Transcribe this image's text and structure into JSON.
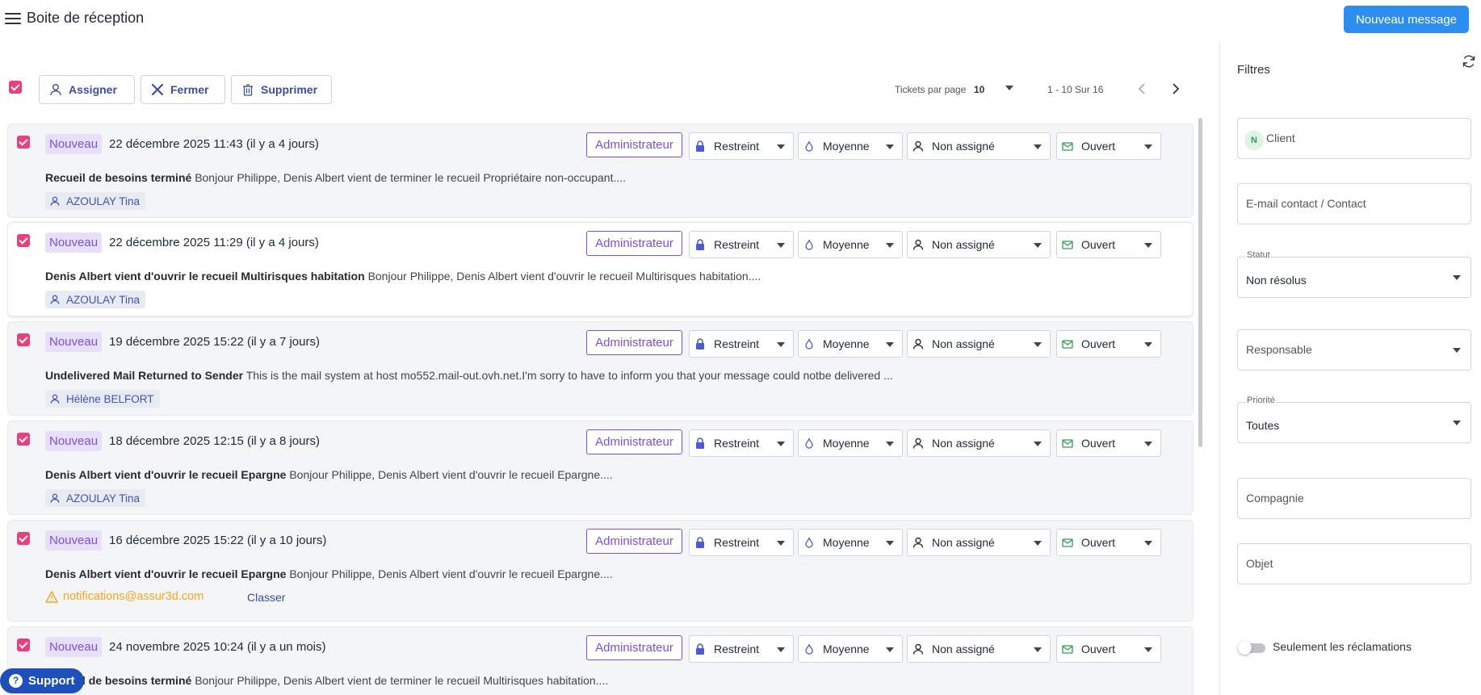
{
  "header": {
    "title": "Boite de réception",
    "new_message_label": "Nouveau message"
  },
  "toolbar": {
    "assign_label": "Assigner",
    "close_label": "Fermer",
    "delete_label": "Supprimer",
    "per_page_label": "Tickets par page",
    "per_page_value": "10",
    "range_text": "1 - 10 Sur 16"
  },
  "tickets": [
    {
      "status": "Nouveau",
      "date": "22 décembre 2025 11:43 (il y a 4 jours)",
      "role": "Administrateur",
      "visibility": "Restreint",
      "priority": "Moyenne",
      "assignee": "Non assigné",
      "state": "Ouvert",
      "subject": "Recueil de besoins terminé",
      "preview": "Bonjour Philippe, Denis Albert vient de terminer le recueil Propriétaire non-occupant....",
      "contact": "AZOULAY Tina"
    },
    {
      "status": "Nouveau",
      "date": "22 décembre 2025 11:29 (il y a 4 jours)",
      "role": "Administrateur",
      "visibility": "Restreint",
      "priority": "Moyenne",
      "assignee": "Non assigné",
      "state": "Ouvert",
      "subject": "Denis Albert vient d'ouvrir le recueil Multirisques habitation",
      "preview": "Bonjour Philippe, Denis Albert vient d'ouvrir le recueil Multirisques habitation....",
      "contact": "AZOULAY Tina"
    },
    {
      "status": "Nouveau",
      "date": "19 décembre 2025 15:22 (il y a 7 jours)",
      "role": "Administrateur",
      "visibility": "Restreint",
      "priority": "Moyenne",
      "assignee": "Non assigné",
      "state": "Ouvert",
      "subject": "Undelivered Mail Returned to Sender",
      "preview": "This is the mail system at host mo552.mail-out.ovh.net.I'm sorry to have to inform you that your message could notbe delivered ...",
      "contact": "Hélène BELFORT"
    },
    {
      "status": "Nouveau",
      "date": "18 décembre 2025 12:15 (il y a 8 jours)",
      "role": "Administrateur",
      "visibility": "Restreint",
      "priority": "Moyenne",
      "assignee": "Non assigné",
      "state": "Ouvert",
      "subject": "Denis Albert vient d'ouvrir le recueil Epargne",
      "preview": "Bonjour Philippe, Denis Albert vient d'ouvrir le recueil Epargne....",
      "contact": "AZOULAY Tina"
    },
    {
      "status": "Nouveau",
      "date": "16 décembre 2025 15:22 (il y a 10 jours)",
      "role": "Administrateur",
      "visibility": "Restreint",
      "priority": "Moyenne",
      "assignee": "Non assigné",
      "state": "Ouvert",
      "subject": "Denis Albert vient d'ouvrir le recueil Epargne",
      "preview": "Bonjour Philippe, Denis Albert vient d'ouvrir le recueil Epargne....",
      "warning_email": "notifications@assur3d.com",
      "classify_label": "Classer"
    },
    {
      "status": "Nouveau",
      "date": "24 novembre 2025 10:24 (il y a un mois)",
      "role": "Administrateur",
      "visibility": "Restreint",
      "priority": "Moyenne",
      "assignee": "Non assigné",
      "state": "Ouvert",
      "subject": "Recueil de besoins terminé",
      "preview": "Bonjour Philippe, Denis Albert vient de terminer le recueil Multirisques habitation...."
    }
  ],
  "filters": {
    "title": "Filtres",
    "client_initial": "N",
    "client_placeholder": "Client",
    "contact_placeholder": "E-mail contact / Contact",
    "status_label": "Statut",
    "status_value": "Non résolus",
    "owner_placeholder": "Responsable",
    "priority_label": "Priorité",
    "priority_value": "Toutes",
    "company_placeholder": "Compagnie",
    "subject_placeholder": "Objet",
    "claims_only_label": "Seulement les réclamations"
  },
  "support": {
    "label": "Support"
  },
  "colors": {
    "primary": "#2d8ef0",
    "accent_pink": "#e8407a",
    "purple": "#7c4fe0",
    "navy": "#3b4ea0",
    "warning": "#f5a623",
    "support": "#1f4fb8"
  }
}
